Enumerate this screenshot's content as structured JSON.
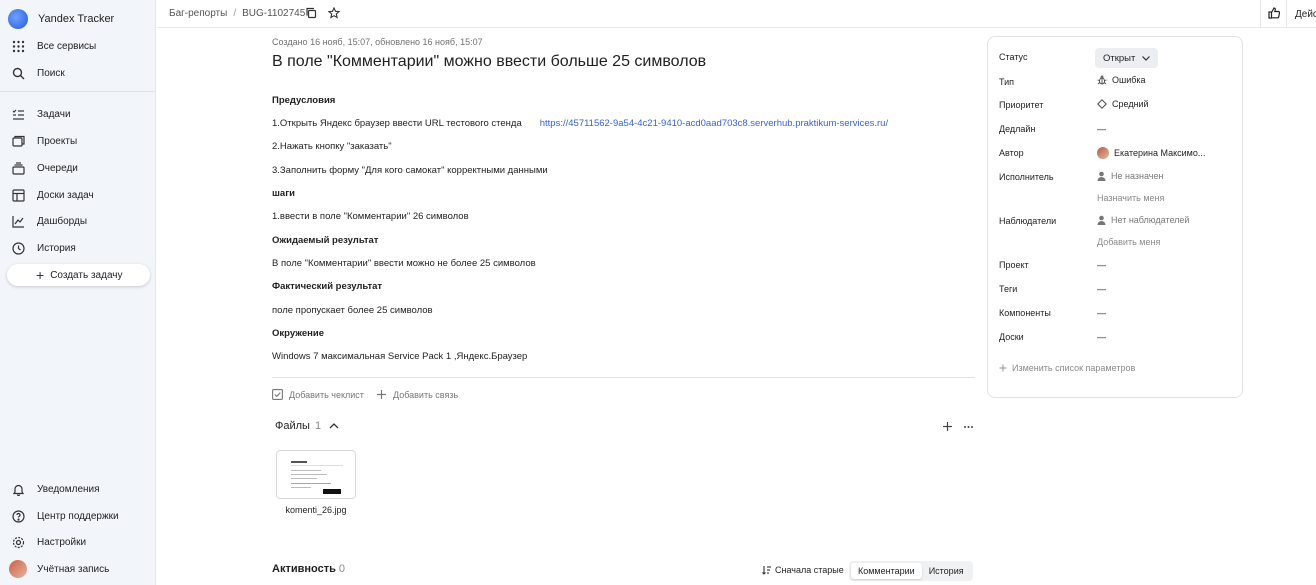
{
  "sidebar": {
    "brand": "Yandex Tracker",
    "top_items": [
      {
        "label": "Все сервисы",
        "icon": "grid-icon"
      },
      {
        "label": "Поиск",
        "icon": "search-icon"
      }
    ],
    "nav_items": [
      {
        "label": "Задачи",
        "icon": "tasks-icon"
      },
      {
        "label": "Проекты",
        "icon": "projects-icon"
      },
      {
        "label": "Очереди",
        "icon": "queues-icon"
      },
      {
        "label": "Доски задач",
        "icon": "board-icon"
      },
      {
        "label": "Дашборды",
        "icon": "dashboard-icon"
      },
      {
        "label": "История",
        "icon": "history-icon"
      }
    ],
    "create_label": "Создать задачу",
    "bottom_items": [
      {
        "label": "Уведомления",
        "icon": "bell-icon"
      },
      {
        "label": "Центр поддержки",
        "icon": "help-icon"
      },
      {
        "label": "Настройки",
        "icon": "gear-icon"
      },
      {
        "label": "Учётная запись",
        "icon": "avatar"
      }
    ]
  },
  "topbar": {
    "breadcrumb_queue": "Баг-репорты",
    "breadcrumb_sep": "/",
    "breadcrumb_key": "BUG-1102745",
    "actions_label": "Действия"
  },
  "issue": {
    "meta": "Создано 16 нояб, 15:07, обновлено 16 нояб, 15:07",
    "title": "В поле \"Комментарии\" можно ввести больше 25 символов",
    "description": [
      {
        "text": "Предусловия",
        "bold": true
      },
      {
        "text": "1.Открыть Яндекс браузер ввести URL тестового стенда",
        "link": "https://45711562-9a54-4c21-9410-acd0aad703c8.serverhub.praktikum-services.ru/"
      },
      {
        "text": "2.Нажать кнопку \"заказать\""
      },
      {
        "text": "3.Заполнить форму \"Для кого самокат\" корректными данными"
      },
      {
        "text": "шаги",
        "bold": true
      },
      {
        "text": "1.ввести в поле \"Комментарии\" 26 символов"
      },
      {
        "text": "Ожидаемый результат",
        "bold": true
      },
      {
        "text": "В поле \"Комментарии\" ввести можно не более 25 символов"
      },
      {
        "text": "Фактический результат",
        "bold": true
      },
      {
        "text": "поле пропускает более 25 символов"
      },
      {
        "text": "Окружение",
        "bold": true
      },
      {
        "text": "Windows 7 максимальная Service Pack 1 ,Яндекс.Браузер"
      }
    ],
    "add_checklist": "Добавить чеклист",
    "add_link": "Добавить связь",
    "files_label": "Файлы",
    "files_count": "1",
    "file_name": "komenti_26.jpg",
    "activity_label": "Активность",
    "activity_count": "0",
    "sort_label": "Сначала старые",
    "tab_comments": "Комментарии",
    "tab_history": "История"
  },
  "panel": {
    "status_label": "Статус",
    "status_value": "Открыт",
    "type_label": "Тип",
    "type_value": "Ошибка",
    "priority_label": "Приоритет",
    "priority_value": "Средний",
    "deadline_label": "Дедлайн",
    "deadline_value": "—",
    "author_label": "Автор",
    "author_value": "Екатерина Максимо...",
    "assignee_label": "Исполнитель",
    "assignee_value": "Не назначен",
    "assign_me": "Назначить меня",
    "watchers_label": "Наблюдатели",
    "watchers_value": "Нет наблюдателей",
    "add_me": "Добавить меня",
    "project_label": "Проект",
    "project_value": "—",
    "tags_label": "Теги",
    "tags_value": "—",
    "components_label": "Компоненты",
    "components_value": "—",
    "boards_label": "Доски",
    "boards_value": "—",
    "edit_params": "Изменить список параметров"
  },
  "colors": {
    "link": "#3a63c8",
    "sidebar_bg": "#f2f5fa",
    "accent": "#2559d6"
  }
}
